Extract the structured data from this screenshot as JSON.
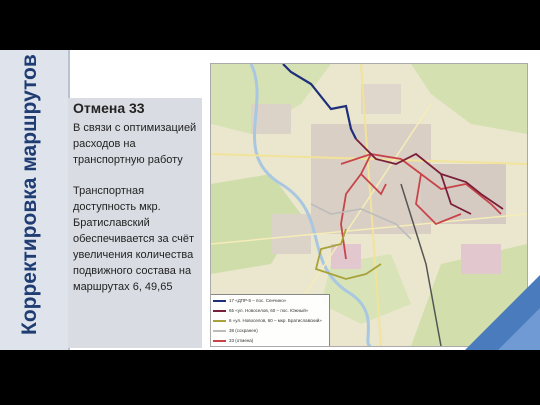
{
  "slide": {
    "title": "Корректировка маршрутов",
    "panel": {
      "heading": "Отмена 33",
      "paragraph1": "В связи с оптимизацией расходов на транспортную работу",
      "paragraph2": "Транспортная доступность мкр. Братиславский обеспечивается за счёт увеличения количества подвижного состава на маршрутах 6, 49,65"
    },
    "map": {
      "legend": [
        {
          "label": "17 «ДПР-5 – пос. Сенчино»",
          "color": "#1f2f7a"
        },
        {
          "label": "65 «ул. Новоселов, 60 – пос. Южный»",
          "color": "#7a1f3a"
        },
        {
          "label": "6 «ул. Новоселов, 60 – мкр. Братиславский»",
          "color": "#a8a23a"
        },
        {
          "label": "38 (сохранен)",
          "color": "#bcbcbc"
        },
        {
          "label": "33 (отмена)",
          "color": "#c8444a"
        }
      ]
    }
  },
  "colors": {
    "title": "#1f3d73",
    "panel_bg": "#d9dde3",
    "accent": "#4a7bbd"
  }
}
